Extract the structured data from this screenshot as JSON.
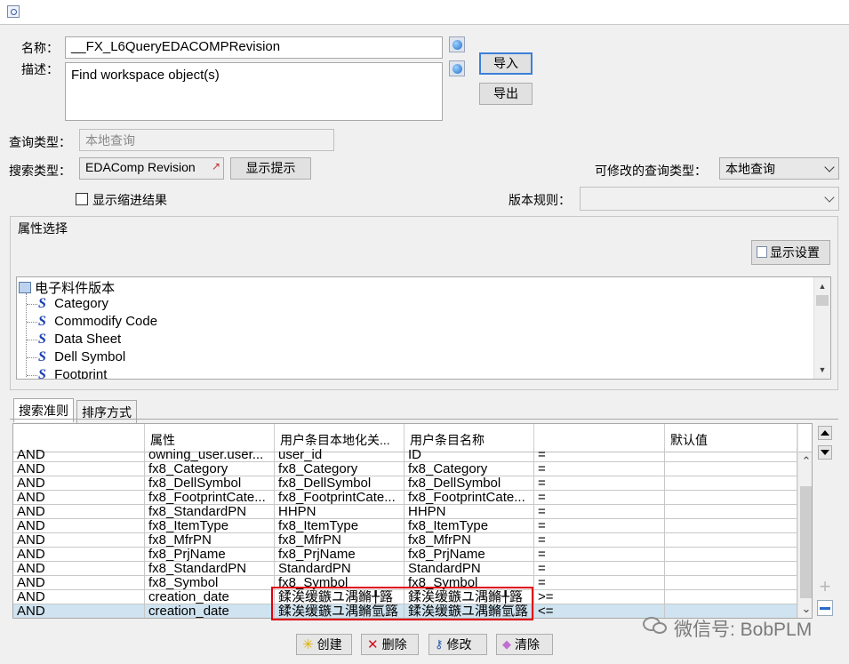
{
  "form": {
    "name_label": "名称：",
    "name_value": "__FX_L6QueryEDACOMPRevision",
    "desc_label": "描述：",
    "desc_value": "Find workspace object(s)",
    "import_label": "导入",
    "export_label": "导出",
    "query_type_label": "查询类型：",
    "query_type_value": "本地查询",
    "search_type_label": "搜索类型：",
    "search_type_value": "EDAComp Revision",
    "show_hint_label": "显示提示",
    "modifiable_type_label": "可修改的查询类型：",
    "modifiable_type_value": "本地查询",
    "show_indented_label": "显示缩进结果",
    "revision_rule_label": "版本规则：",
    "revision_rule_value": ""
  },
  "attributes": {
    "group_title": "属性选择",
    "display_settings_label": "显示设置",
    "root_label": "电子料件版本",
    "items": [
      "Category",
      "Commodify Code",
      "Data Sheet",
      "Dell Symbol",
      "Footprint"
    ]
  },
  "tabs": [
    {
      "label": "搜索准则"
    },
    {
      "label": "排序方式"
    }
  ],
  "criteria": {
    "headers": [
      "",
      "属性",
      "用户条目本地化关...",
      "用户条目名称",
      "",
      "默认值"
    ],
    "rows": [
      [
        "AND",
        "owning_user.user...",
        "user_id",
        "ID",
        "=",
        ""
      ],
      [
        "AND",
        "fx8_Category",
        "fx8_Category",
        "fx8_Category",
        "=",
        ""
      ],
      [
        "AND",
        "fx8_DellSymbol",
        "fx8_DellSymbol",
        "fx8_DellSymbol",
        "=",
        ""
      ],
      [
        "AND",
        "fx8_FootprintCate...",
        "fx8_FootprintCate...",
        "fx8_FootprintCate...",
        "=",
        ""
      ],
      [
        "AND",
        "fx8_StandardPN",
        "HHPN",
        "HHPN",
        "=",
        ""
      ],
      [
        "AND",
        "fx8_ItemType",
        "fx8_ItemType",
        "fx8_ItemType",
        "=",
        ""
      ],
      [
        "AND",
        "fx8_MfrPN",
        "fx8_MfrPN",
        "fx8_MfrPN",
        "=",
        ""
      ],
      [
        "AND",
        "fx8_PrjName",
        "fx8_PrjName",
        "fx8_PrjName",
        "=",
        ""
      ],
      [
        "AND",
        "fx8_StandardPN",
        "StandardPN",
        "StandardPN",
        "=",
        ""
      ],
      [
        "AND",
        "fx8_Symbol",
        "fx8_Symbol",
        "fx8_Symbol",
        "=",
        ""
      ],
      [
        "AND",
        "creation_date",
        "鍒涘缓鏃ユ湡鏅╀簬",
        "鍒涘缓鏃ユ湡鏅╀簬",
        ">=",
        ""
      ],
      [
        "AND",
        "creation_date",
        "鍒涘缓鏃ユ湡鏅氫簬",
        "鍒涘缓鏃ユ湡鏅氫簬",
        "<=",
        ""
      ]
    ]
  },
  "actions": {
    "create_label": "创建",
    "delete_label": "删除",
    "modify_label": "修改",
    "clear_label": "清除"
  },
  "watermark": "微信号: BobPLM"
}
